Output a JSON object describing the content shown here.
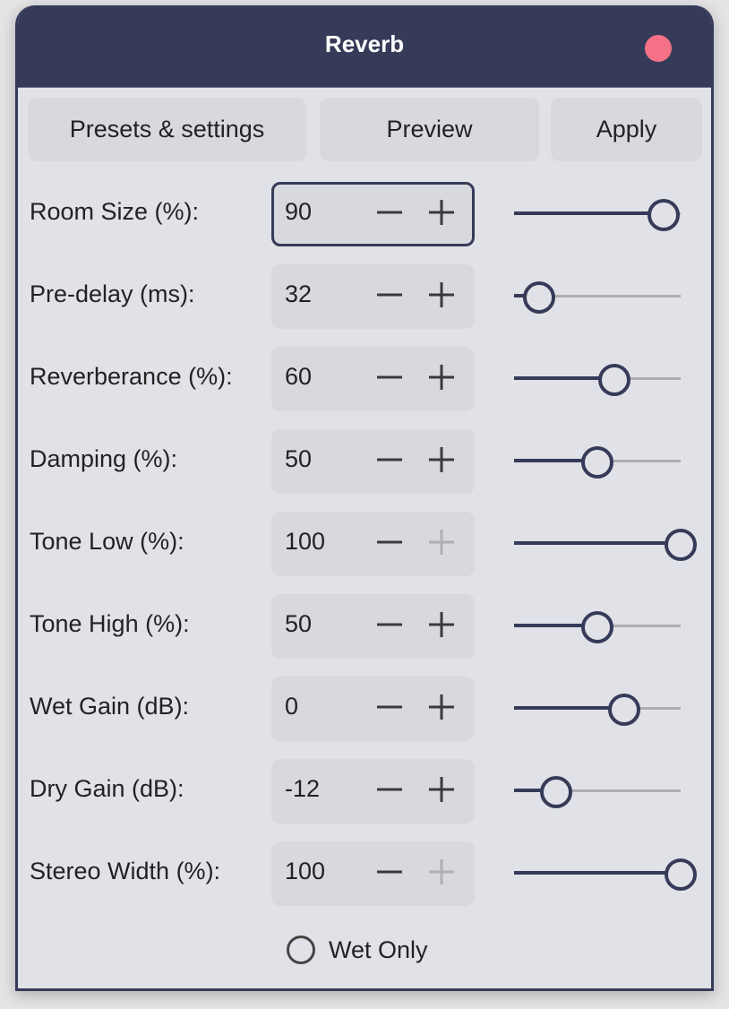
{
  "window": {
    "title": "Reverb",
    "close_color": "#f47186",
    "accent_color": "#353b58"
  },
  "toolbar": {
    "presets_label": "Presets & settings",
    "preview_label": "Preview",
    "apply_label": "Apply"
  },
  "params": [
    {
      "label": "Room Size (%):",
      "value": "90",
      "slider_percent": 90,
      "plus_enabled": true,
      "focused": true
    },
    {
      "label": "Pre-delay (ms):",
      "value": "32",
      "slider_percent": 15,
      "plus_enabled": true,
      "focused": false
    },
    {
      "label": "Reverberance (%):",
      "value": "60",
      "slider_percent": 60,
      "plus_enabled": true,
      "focused": false
    },
    {
      "label": "Damping (%):",
      "value": "50",
      "slider_percent": 50,
      "plus_enabled": true,
      "focused": false
    },
    {
      "label": "Tone Low (%):",
      "value": "100",
      "slider_percent": 100,
      "plus_enabled": false,
      "focused": false
    },
    {
      "label": "Tone High (%):",
      "value": "50",
      "slider_percent": 50,
      "plus_enabled": true,
      "focused": false
    },
    {
      "label": "Wet Gain (dB):",
      "value": "0",
      "slider_percent": 66,
      "plus_enabled": true,
      "focused": false
    },
    {
      "label": "Dry Gain (dB):",
      "value": "-12",
      "slider_percent": 25,
      "plus_enabled": true,
      "focused": false
    },
    {
      "label": "Stereo Width (%):",
      "value": "100",
      "slider_percent": 100,
      "plus_enabled": false,
      "focused": false
    }
  ],
  "wet_only": {
    "label": "Wet Only",
    "checked": false
  }
}
